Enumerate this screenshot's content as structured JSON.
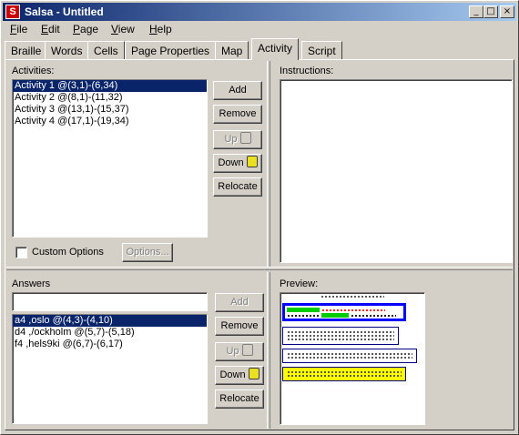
{
  "window": {
    "title": "Salsa - Untitled",
    "app_icon_glyph": "S",
    "minimize_glyph": "_",
    "maximize_glyph": "□",
    "close_glyph": "×"
  },
  "menu": {
    "file_first": "F",
    "file_rest": "ile",
    "edit_first": "E",
    "edit_rest": "dit",
    "page_first": "P",
    "page_rest": "age",
    "view_first": "V",
    "view_rest": "iew",
    "help_first": "H",
    "help_rest": "elp"
  },
  "tabs": {
    "braille": "Braille",
    "words": "Words",
    "cells": "Cells",
    "page_properties": "Page Properties",
    "map": "Map",
    "activity": "Activity",
    "script": "Script"
  },
  "activities": {
    "label": "Activities:",
    "items": [
      "Activity 1 @(3,1)-(6,34)",
      "Activity 2 @(8,1)-(11,32)",
      "Activity 3 @(13,1)-(15,37)",
      "Activity 4 @(17,1)-(19,34)"
    ],
    "add": "Add",
    "remove": "Remove",
    "up": "Up",
    "down": "Down",
    "relocate": "Relocate",
    "custom_options": "Custom Options",
    "options_button": "Options..."
  },
  "instructions": {
    "label": "Instructions:"
  },
  "answers": {
    "label": "Answers",
    "input_value": "",
    "items": [
      "a4 ,oslo @(4,3)-(4,10)",
      "d4 ,/ockholm @(5,7)-(5,18)",
      "f4 ,hels9ki @(6,7)-(6,17)"
    ],
    "add": "Add",
    "remove": "Remove",
    "up": "Up",
    "down": "Down",
    "relocate": "Relocate"
  },
  "preview": {
    "label": "Preview:",
    "colors": {
      "blue": "#0000ff",
      "green": "#00cc00",
      "red": "#ff0000",
      "yellow": "#ffff00",
      "navy": "#000080"
    }
  }
}
